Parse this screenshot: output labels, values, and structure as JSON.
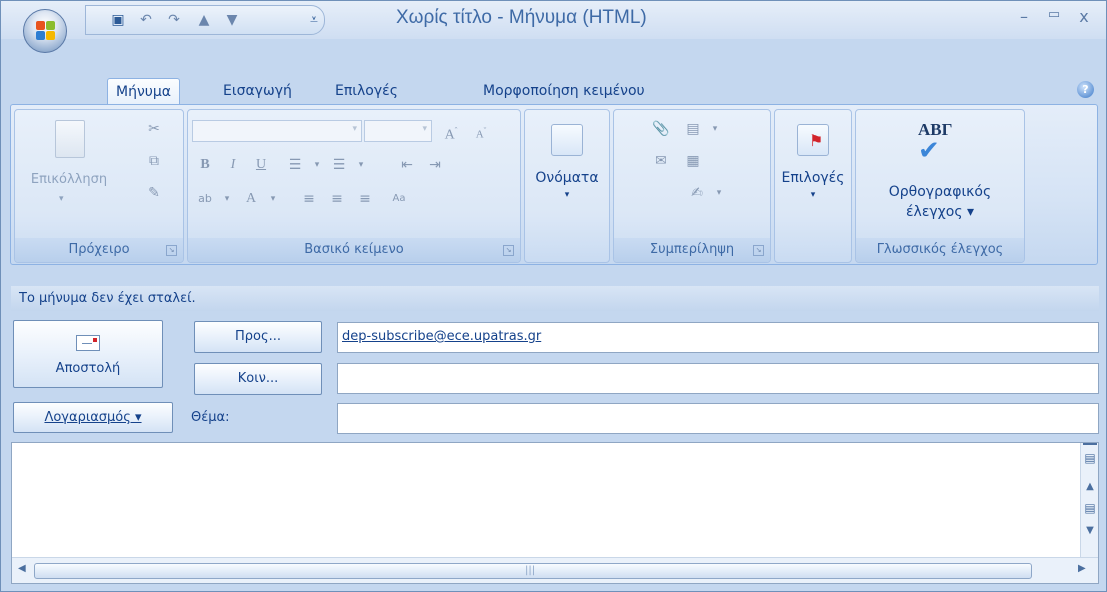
{
  "window": {
    "title": "Χωρίς τίτλο - Μήνυμα (HTML)",
    "accent": "#15428b",
    "frame_color": "#c4d7ef"
  },
  "quick_access": [
    "save-icon",
    "undo-icon",
    "redo-icon",
    "up-arrow-icon",
    "down-arrow-icon",
    "customize-icon"
  ],
  "tabs": [
    {
      "label": "Μήνυμα",
      "active": true
    },
    {
      "label": "Εισαγωγή",
      "active": false
    },
    {
      "label": "Επιλογές",
      "active": false
    },
    {
      "label": "Μορφοποίηση κειμένου",
      "active": false
    }
  ],
  "ribbon": {
    "clipboard": {
      "label": "Πρόχειρο",
      "paste": "Επικόλληση"
    },
    "basic_text": {
      "label": "Βασικό κείμενο"
    },
    "names": {
      "label": "Ονόματα"
    },
    "include": {
      "label": "Συμπερίληψη"
    },
    "options": {
      "label": "Επιλογές"
    },
    "proofing": {
      "label": "Γλωσσικός έλεγχος",
      "spelling": "Ορθογραφικός έλεγχος",
      "spelling_line1": "Ορθογραφικός",
      "spelling_line2": "έλεγχος ▾",
      "icon_text": "ΑΒΓ"
    }
  },
  "status_message": "Το μήνυμα δεν έχει σταλεί.",
  "header": {
    "send_label": "Αποστολή",
    "to_button": "Προς...",
    "cc_button": "Κοιν...",
    "account_button": "Λογαριασμός ▾",
    "subject_label": "Θέμα:",
    "to_value": "dep-subscribe@ece.upatras.gr",
    "cc_value": "",
    "subject_value": ""
  }
}
